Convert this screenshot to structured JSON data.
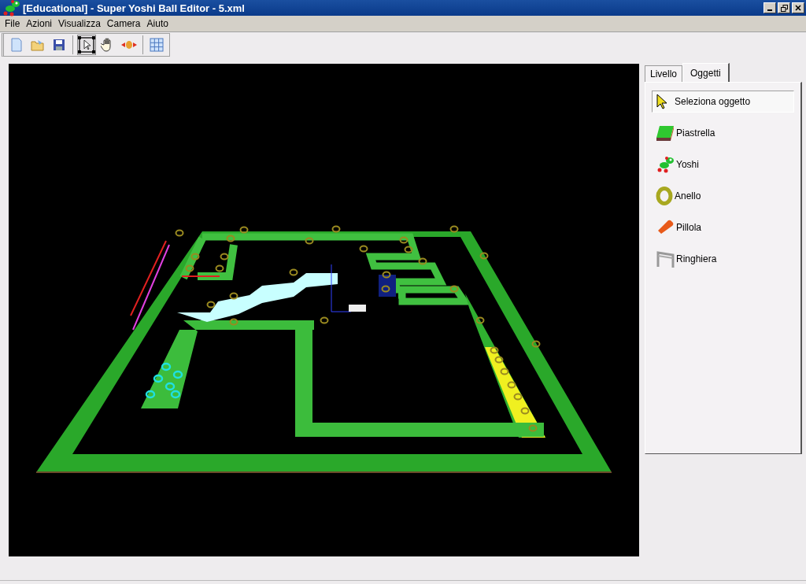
{
  "window": {
    "title": "[Educational] - Super Yoshi Ball Editor - 5.xml"
  },
  "menu": [
    "File",
    "Azioni",
    "Visualizza",
    "Camera",
    "Aiuto"
  ],
  "toolbar": [
    {
      "kind": "new",
      "selected": false
    },
    {
      "kind": "open",
      "selected": false
    },
    {
      "kind": "save",
      "selected": false
    },
    {
      "kind": "select",
      "selected": true
    },
    {
      "kind": "pan",
      "selected": false
    },
    {
      "kind": "rotate",
      "selected": false
    },
    {
      "kind": "grid",
      "selected": false
    }
  ],
  "tabs": [
    {
      "label": "Livello",
      "selected": false
    },
    {
      "label": "Oggetti",
      "selected": true
    }
  ],
  "objects": [
    {
      "kind": "cursor",
      "label": "Seleziona oggetto",
      "selected": true
    },
    {
      "kind": "tile",
      "label": "Piastrella",
      "selected": false
    },
    {
      "kind": "yoshi",
      "label": "Yoshi",
      "selected": false
    },
    {
      "kind": "ring",
      "label": "Anello",
      "selected": false
    },
    {
      "kind": "pill",
      "label": "Pillola",
      "selected": false
    },
    {
      "kind": "railing",
      "label": "Ringhiera",
      "selected": false
    }
  ]
}
